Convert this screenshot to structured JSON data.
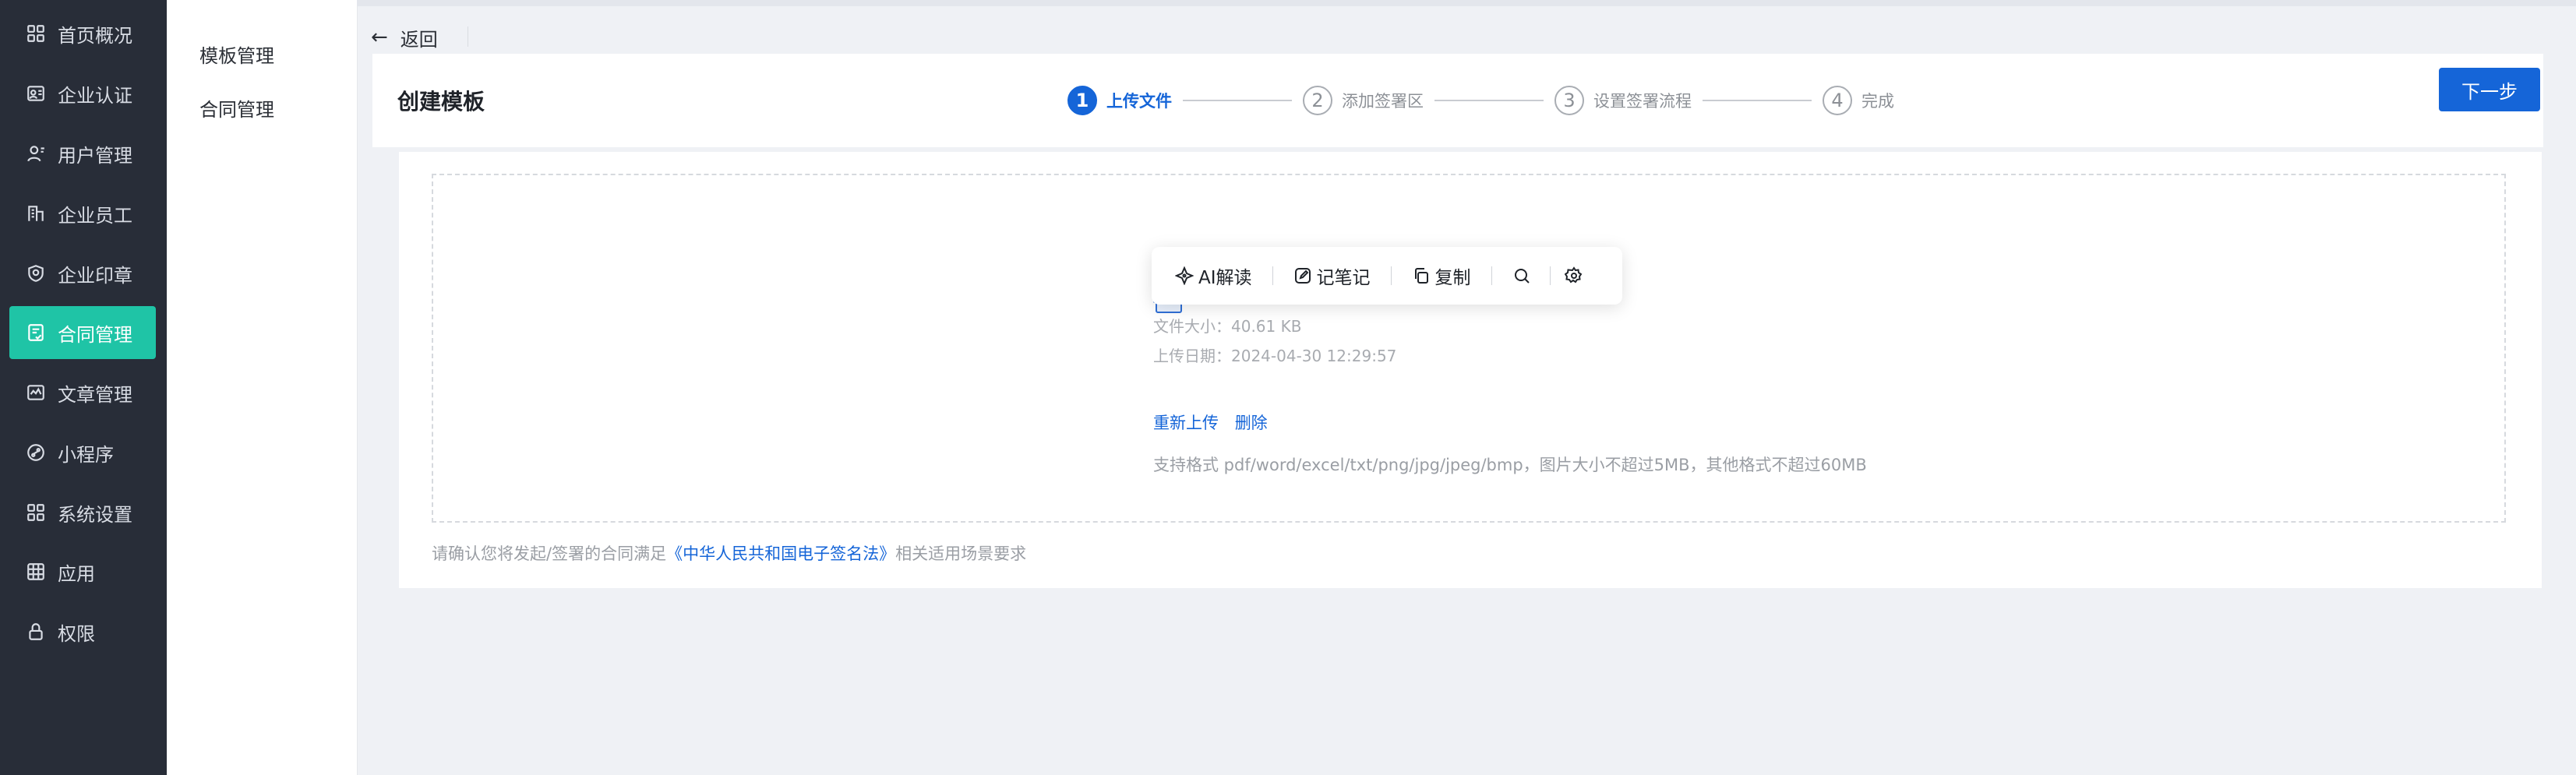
{
  "nav": {
    "items": [
      {
        "label": "首页概况",
        "icon": "grid-icon"
      },
      {
        "label": "企业认证",
        "icon": "id-card-icon"
      },
      {
        "label": "用户管理",
        "icon": "user-icon"
      },
      {
        "label": "企业员工",
        "icon": "building-icon"
      },
      {
        "label": "企业印章",
        "icon": "seal-icon"
      },
      {
        "label": "合同管理",
        "icon": "contract-icon"
      },
      {
        "label": "文章管理",
        "icon": "article-icon"
      },
      {
        "label": "小程序",
        "icon": "mini-program-icon"
      },
      {
        "label": "系统设置",
        "icon": "settings-grid-icon"
      },
      {
        "label": "应用",
        "icon": "app-icon"
      },
      {
        "label": "权限",
        "icon": "lock-icon"
      }
    ],
    "active_index": 5
  },
  "subnav": {
    "items": [
      {
        "label": "模板管理"
      },
      {
        "label": "合同管理"
      }
    ]
  },
  "back_label": "返回",
  "header": {
    "title": "创建模板",
    "steps": [
      {
        "num": "1",
        "label": "上传文件"
      },
      {
        "num": "2",
        "label": "添加签署区"
      },
      {
        "num": "3",
        "label": "设置签署流程"
      },
      {
        "num": "4",
        "label": "完成"
      }
    ],
    "active_step": 0,
    "next_label": "下一步"
  },
  "upload": {
    "file_size": "文件大小：40.61 KB",
    "upload_date": "上传日期：2024-04-30 12:29:57",
    "reupload_label": "重新上传",
    "delete_label": "删除",
    "format_hint": "支持格式 pdf/word/excel/txt/png/jpg/jpeg/bmp，图片大小不超过5MB，其他格式不超过60MB"
  },
  "footnote": {
    "prefix": "请确认您将发起/签署的合同满足",
    "law": "《中华人民共和国电子签名法》",
    "suffix": "相关适用场景要求"
  },
  "toolbar": {
    "ai_label": "AI解读",
    "note_label": "记笔记",
    "copy_label": "复制"
  },
  "colors": {
    "nav_bg": "#282d38",
    "nav_active": "#1fc4a6",
    "primary": "#1565d8",
    "page_bg": "#eff1f5"
  }
}
